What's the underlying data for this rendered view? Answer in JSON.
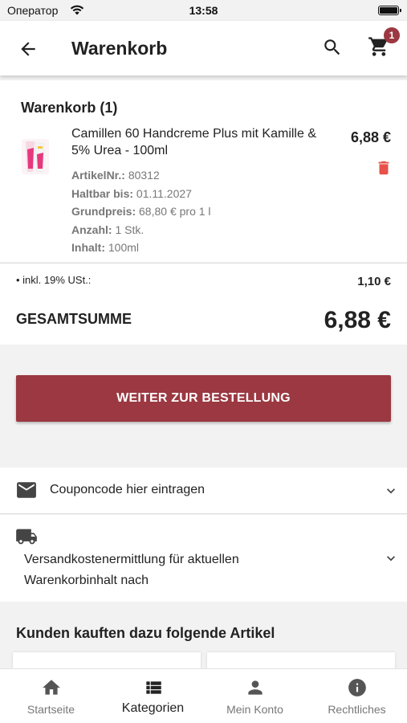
{
  "status_bar": {
    "carrier": "Оператор",
    "time": "13:58"
  },
  "app_bar": {
    "title": "Warenkorb",
    "cart_badge": "1"
  },
  "cart": {
    "heading": "Warenkorb (1)",
    "item": {
      "name": "Camillen 60 Handcreme Plus mit Kamille & 5% Urea - 100ml",
      "price": "6,88 €",
      "details": [
        {
          "label": "ArtikelNr.:",
          "value": "80312"
        },
        {
          "label": "Haltbar bis:",
          "value": "01.11.2027"
        },
        {
          "label": "Grundpreis:",
          "value": "68,80 € pro 1 l"
        },
        {
          "label": "Anzahl:",
          "value": "1 Stk."
        },
        {
          "label": "Inhalt:",
          "value": "100ml"
        }
      ]
    }
  },
  "totals": {
    "vat_label": "• inkl. 19% USt.:",
    "vat_value": "1,10 €",
    "sum_label": "GESAMTSUMME",
    "sum_value": "6,88 €"
  },
  "checkout_button": "WEITER ZUR BESTELLUNG",
  "coupon": {
    "label": "Couponcode hier eintragen"
  },
  "shipping": {
    "label": "Versandkostenermittlung für aktuellen Warenkorbinhalt nach"
  },
  "recommendations": {
    "title": "Kunden kauften dazu folgende Artikel"
  },
  "tabs": [
    {
      "label": "Startseite",
      "icon": "home-icon"
    },
    {
      "label": "Kategorien",
      "icon": "list-icon"
    },
    {
      "label": "Mein Konto",
      "icon": "person-icon"
    },
    {
      "label": "Rechtliches",
      "icon": "info-icon"
    }
  ],
  "colors": {
    "accent": "#9b3841",
    "delete": "#e8504a",
    "muted_text": "#777777"
  }
}
